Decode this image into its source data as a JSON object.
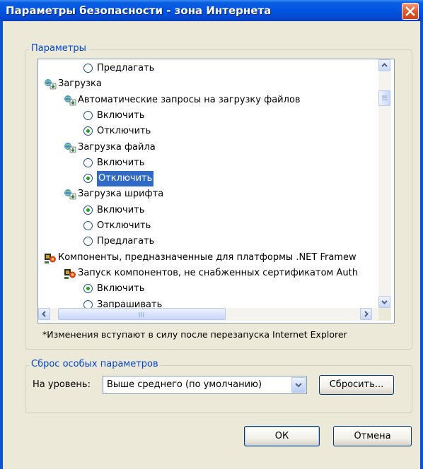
{
  "window": {
    "title": "Параметры безопасности - зона Интернета"
  },
  "settings_group": {
    "legend": "Параметры"
  },
  "tree": {
    "rows": [
      {
        "kind": "radio",
        "label": "Предлагать",
        "checked": false
      },
      {
        "kind": "category",
        "label": "Загрузка",
        "icon": "gear-globe-icon"
      },
      {
        "kind": "subcategory",
        "label": "Автоматические запросы на загрузку файлов",
        "icon": "gear-globe-icon"
      },
      {
        "kind": "radio",
        "label": "Включить",
        "checked": false
      },
      {
        "kind": "radio",
        "label": "Отключить",
        "checked": true
      },
      {
        "kind": "subcategory",
        "label": "Загрузка файла",
        "icon": "gear-globe-icon"
      },
      {
        "kind": "radio",
        "label": "Включить",
        "checked": false
      },
      {
        "kind": "radio",
        "label": "Отключить",
        "checked": true,
        "selected": true
      },
      {
        "kind": "subcategory",
        "label": "Загрузка шрифта",
        "icon": "gear-globe-icon"
      },
      {
        "kind": "radio",
        "label": "Включить",
        "checked": true
      },
      {
        "kind": "radio",
        "label": "Отключить",
        "checked": false
      },
      {
        "kind": "radio",
        "label": "Предлагать",
        "checked": false
      },
      {
        "kind": "category",
        "label": "Компоненты, предназначенные для платформы .NET Framew",
        "icon": "dotnet-components-icon"
      },
      {
        "kind": "subcategory",
        "label": "Запуск компонентов, не снабженных сертификатом Auth",
        "icon": "dotnet-components-icon"
      },
      {
        "kind": "radio",
        "label": "Включить",
        "checked": true
      },
      {
        "kind": "radio",
        "label": "Запрашивать",
        "checked": false
      }
    ]
  },
  "note": "*Изменения вступают в силу после перезапуска Internet Explorer",
  "reset_group": {
    "legend": "Сброс особых параметров",
    "level_label": "На уровень:",
    "level_value": "Выше среднего (по умолчанию)",
    "reset_button": "Сбросить..."
  },
  "buttons": {
    "ok": "ОК",
    "cancel": "Отмена"
  },
  "colors": {
    "accent": "#0054e3",
    "selection": "#316ac5",
    "radio_dot": "#21a121",
    "legend": "#0046d5"
  }
}
